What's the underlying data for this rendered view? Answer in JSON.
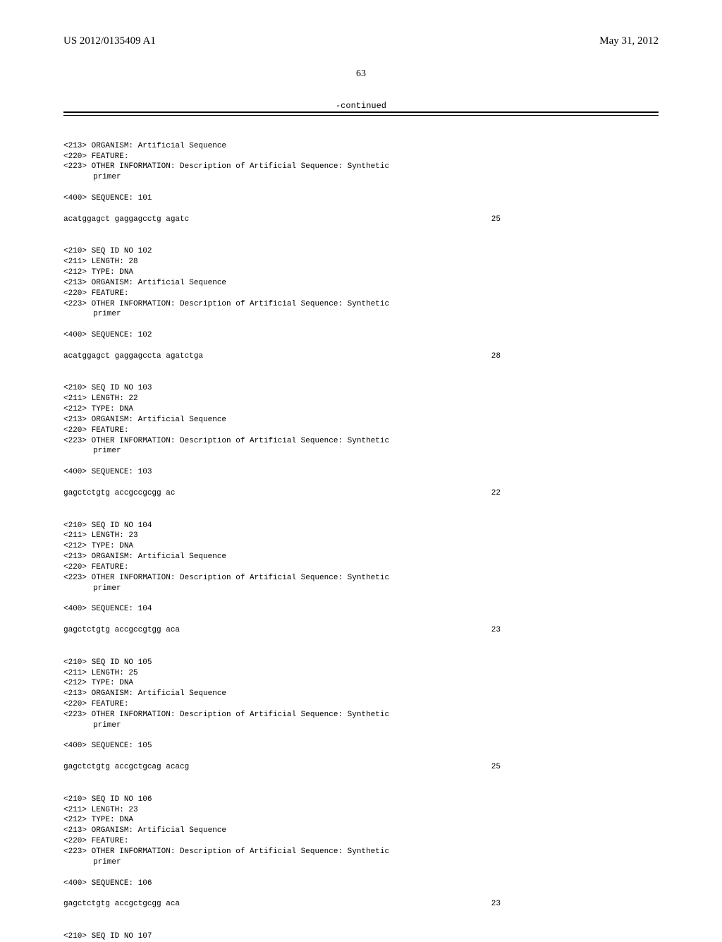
{
  "header": {
    "pub_number": "US 2012/0135409 A1",
    "date": "May 31, 2012"
  },
  "page_number": "63",
  "continued_label": "-continued",
  "entries": [
    {
      "pre_lines": [
        "<213> ORGANISM: Artificial Sequence",
        "<220> FEATURE:",
        "<223> OTHER INFORMATION: Description of Artificial Sequence: Synthetic"
      ],
      "pre_indent": "primer",
      "seq_header": "<400> SEQUENCE: 101",
      "sequence": "acatggagct gaggagcctg agatc",
      "position": "25"
    },
    {
      "pre_lines": [
        "<210> SEQ ID NO 102",
        "<211> LENGTH: 28",
        "<212> TYPE: DNA",
        "<213> ORGANISM: Artificial Sequence",
        "<220> FEATURE:",
        "<223> OTHER INFORMATION: Description of Artificial Sequence: Synthetic"
      ],
      "pre_indent": "primer",
      "seq_header": "<400> SEQUENCE: 102",
      "sequence": "acatggagct gaggagccta agatctga",
      "position": "28"
    },
    {
      "pre_lines": [
        "<210> SEQ ID NO 103",
        "<211> LENGTH: 22",
        "<212> TYPE: DNA",
        "<213> ORGANISM: Artificial Sequence",
        "<220> FEATURE:",
        "<223> OTHER INFORMATION: Description of Artificial Sequence: Synthetic"
      ],
      "pre_indent": "primer",
      "seq_header": "<400> SEQUENCE: 103",
      "sequence": "gagctctgtg accgccgcgg ac",
      "position": "22"
    },
    {
      "pre_lines": [
        "<210> SEQ ID NO 104",
        "<211> LENGTH: 23",
        "<212> TYPE: DNA",
        "<213> ORGANISM: Artificial Sequence",
        "<220> FEATURE:",
        "<223> OTHER INFORMATION: Description of Artificial Sequence: Synthetic"
      ],
      "pre_indent": "primer",
      "seq_header": "<400> SEQUENCE: 104",
      "sequence": "gagctctgtg accgccgtgg aca",
      "position": "23"
    },
    {
      "pre_lines": [
        "<210> SEQ ID NO 105",
        "<211> LENGTH: 25",
        "<212> TYPE: DNA",
        "<213> ORGANISM: Artificial Sequence",
        "<220> FEATURE:",
        "<223> OTHER INFORMATION: Description of Artificial Sequence: Synthetic"
      ],
      "pre_indent": "primer",
      "seq_header": "<400> SEQUENCE: 105",
      "sequence": "gagctctgtg accgctgcag acacg",
      "position": "25"
    },
    {
      "pre_lines": [
        "<210> SEQ ID NO 106",
        "<211> LENGTH: 23",
        "<212> TYPE: DNA",
        "<213> ORGANISM: Artificial Sequence",
        "<220> FEATURE:",
        "<223> OTHER INFORMATION: Description of Artificial Sequence: Synthetic"
      ],
      "pre_indent": "primer",
      "seq_header": "<400> SEQUENCE: 106",
      "sequence": "gagctctgtg accgctgcgg aca",
      "position": "23"
    },
    {
      "pre_lines": [
        "<210> SEQ ID NO 107"
      ],
      "pre_indent": null,
      "seq_header": null,
      "sequence": null,
      "position": null
    }
  ]
}
